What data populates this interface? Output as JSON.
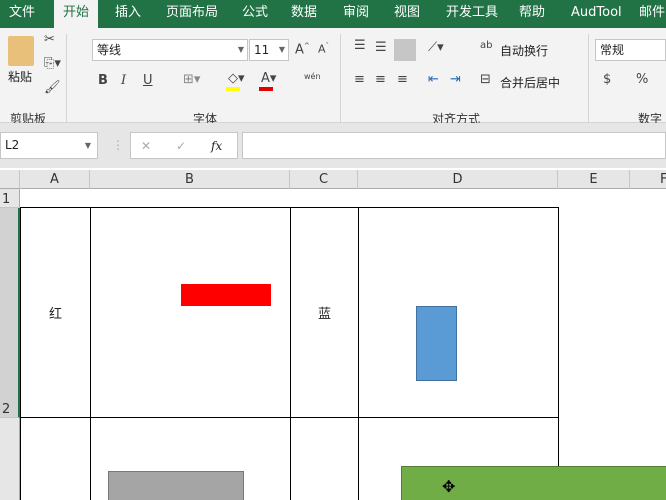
{
  "tabs": [
    "文件",
    "开始",
    "插入",
    "页面布局",
    "公式",
    "数据",
    "审阅",
    "视图",
    "开发工具",
    "帮助",
    "AudTool",
    "邮件"
  ],
  "ribbon": {
    "clipboard": {
      "paste": "粘贴",
      "group": "剪贴板"
    },
    "font": {
      "name": "等线",
      "size": "11",
      "bold": "B",
      "italic": "I",
      "underline": "U",
      "group": "字体",
      "phonetic": "wén"
    },
    "align": {
      "wrap": "自动换行",
      "merge": "合并后居中",
      "group": "对齐方式"
    },
    "number": {
      "format": "常规",
      "currency": "$",
      "percent": "%",
      "group": "数字"
    },
    "colors": {
      "fill": "#ffff00",
      "font": "#e00000"
    }
  },
  "formula_bar": {
    "name_box": "L2",
    "fx": "fx",
    "value": ""
  },
  "columns": [
    "A",
    "B",
    "C",
    "D",
    "E",
    "F"
  ],
  "rows": [
    "1",
    "2"
  ],
  "cells": {
    "A2": "红",
    "C2": "蓝"
  },
  "shapes": {
    "red": "#ff0000",
    "blue": "#5b9bd5",
    "gray": "#a5a5a5",
    "green": "#70ad47"
  }
}
